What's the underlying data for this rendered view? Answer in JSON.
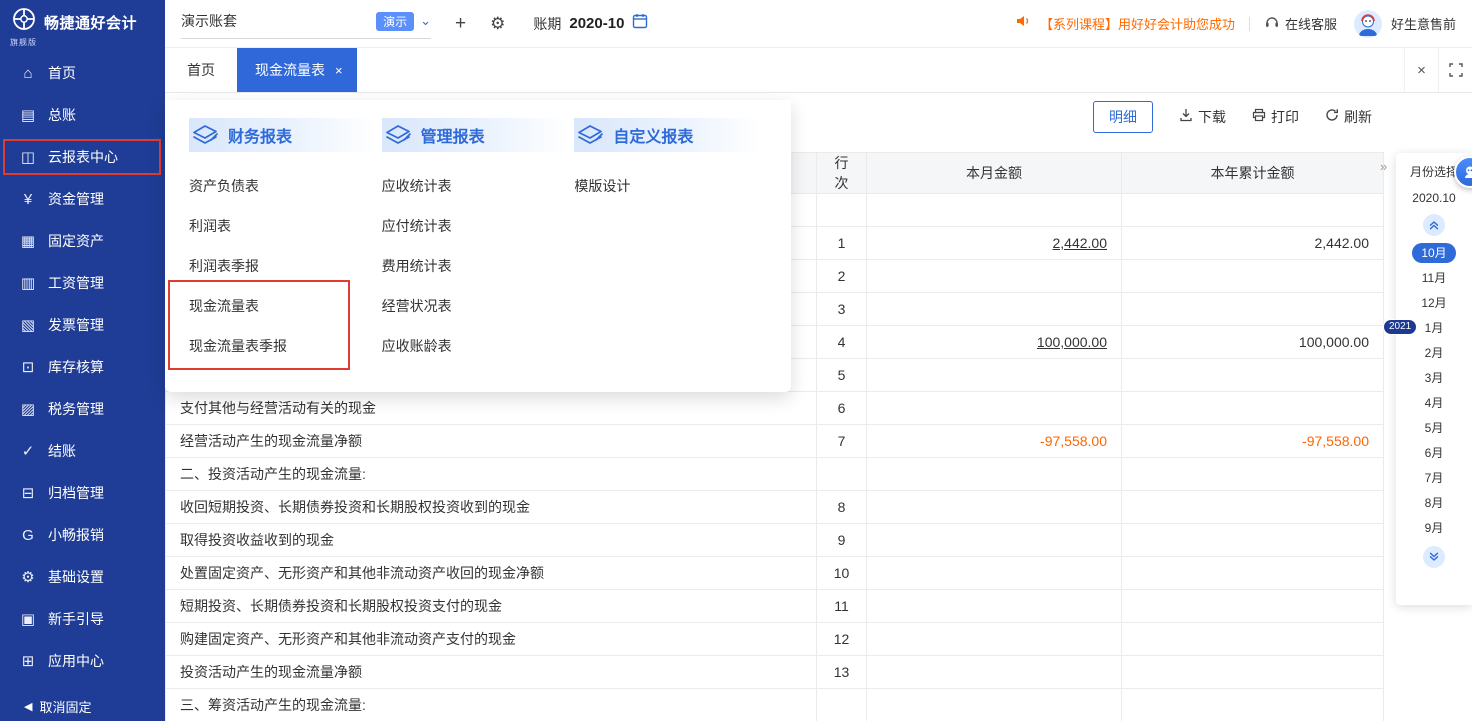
{
  "app": {
    "name": "畅捷通好会计",
    "edition": "旗舰版"
  },
  "sidebar": {
    "items": [
      {
        "key": "home",
        "label": "首页"
      },
      {
        "key": "general-ledger",
        "label": "总账"
      },
      {
        "key": "cloud-report-center",
        "label": "云报表中心",
        "highlighted": true
      },
      {
        "key": "fund-management",
        "label": "资金管理"
      },
      {
        "key": "fixed-assets",
        "label": "固定资产"
      },
      {
        "key": "salary-management",
        "label": "工资管理"
      },
      {
        "key": "invoice-management",
        "label": "发票管理"
      },
      {
        "key": "inventory-accounting",
        "label": "库存核算"
      },
      {
        "key": "tax-management",
        "label": "税务管理"
      },
      {
        "key": "closing",
        "label": "结账"
      },
      {
        "key": "archive-management",
        "label": "归档管理"
      },
      {
        "key": "xiaochang-reimburse",
        "label": "小畅报销"
      },
      {
        "key": "basic-settings",
        "label": "基础设置"
      },
      {
        "key": "beginner-guide",
        "label": "新手引导"
      },
      {
        "key": "app-center",
        "label": "应用中心"
      }
    ],
    "unpin_label": "取消固定"
  },
  "topbar": {
    "account_name": "演示账套",
    "demo_badge": "演示",
    "period_label": "账期",
    "period_value": "2020-10",
    "promo_text": "【系列课程】用好好会计助您成功",
    "service_label": "在线客服",
    "user_name": "好生意售前"
  },
  "tabs": [
    {
      "label": "首页",
      "active": false
    },
    {
      "label": "现金流量表",
      "active": true,
      "closable": true
    }
  ],
  "report_menu": {
    "sections": [
      {
        "key": "financial-reports",
        "title": "财务报表",
        "items": [
          "资产负债表",
          "利润表",
          "利润表季报",
          "现金流量表",
          "现金流量表季报"
        ]
      },
      {
        "key": "management-reports",
        "title": "管理报表",
        "items": [
          "应收统计表",
          "应付统计表",
          "费用统计表",
          "经营状况表",
          "应收账龄表"
        ]
      },
      {
        "key": "custom-reports",
        "title": "自定义报表",
        "items": [
          "模版设计"
        ]
      }
    ]
  },
  "toolbar": {
    "detail_label": "明细",
    "download_label": "下载",
    "print_label": "打印",
    "refresh_label": "刷新"
  },
  "table": {
    "headers": {
      "item": "",
      "line": "行次",
      "month": "本月金额",
      "year": "本年累计金额"
    },
    "rows": [
      {
        "item": "",
        "line": "",
        "month": "",
        "year": ""
      },
      {
        "item": "",
        "line": "1",
        "month": "2,442.00",
        "year": "2,442.00",
        "month_link": true
      },
      {
        "item": "",
        "line": "2",
        "month": "",
        "year": ""
      },
      {
        "item": "",
        "line": "3",
        "month": "",
        "year": ""
      },
      {
        "item": "",
        "line": "4",
        "month": "100,000.00",
        "year": "100,000.00",
        "month_link": true
      },
      {
        "item": "",
        "line": "5",
        "month": "",
        "year": ""
      },
      {
        "item": "支付其他与经营活动有关的现金",
        "line": "6",
        "month": "",
        "year": ""
      },
      {
        "item": "经营活动产生的现金流量净额",
        "line": "7",
        "month": "-97,558.00",
        "year": "-97,558.00"
      },
      {
        "item": "二、投资活动产生的现金流量:",
        "line": "",
        "month": "",
        "year": ""
      },
      {
        "item": "收回短期投资、长期债券投资和长期股权投资收到的现金",
        "line": "8",
        "month": "",
        "year": ""
      },
      {
        "item": "取得投资收益收到的现金",
        "line": "9",
        "month": "",
        "year": ""
      },
      {
        "item": "处置固定资产、无形资产和其他非流动资产收回的现金净额",
        "line": "10",
        "month": "",
        "year": ""
      },
      {
        "item": "短期投资、长期债券投资和长期股权投资支付的现金",
        "line": "11",
        "month": "",
        "year": ""
      },
      {
        "item": "购建固定资产、无形资产和其他非流动资产支付的现金",
        "line": "12",
        "month": "",
        "year": ""
      },
      {
        "item": "投资活动产生的现金流量净额",
        "line": "13",
        "month": "",
        "year": ""
      },
      {
        "item": "三、筹资活动产生的现金流量:",
        "line": "",
        "month": "",
        "year": ""
      }
    ]
  },
  "month_panel": {
    "title": "月份选择",
    "current": "2020.10",
    "months": [
      {
        "label": "10月",
        "selected": true
      },
      {
        "label": "11月"
      },
      {
        "label": "12月"
      },
      {
        "label": "1月",
        "year_badge": "2021"
      },
      {
        "label": "2月"
      },
      {
        "label": "3月"
      },
      {
        "label": "4月"
      },
      {
        "label": "5月"
      },
      {
        "label": "6月"
      },
      {
        "label": "7月"
      },
      {
        "label": "8月"
      },
      {
        "label": "9月"
      }
    ]
  },
  "colors": {
    "sidebar_bg": "#1f3d96",
    "accent_blue": "#2f6bd8",
    "active_tab": "#3168d9",
    "highlight_red": "#e03c32",
    "promo_orange": "#ff6a00",
    "negative": "#ff6600"
  }
}
